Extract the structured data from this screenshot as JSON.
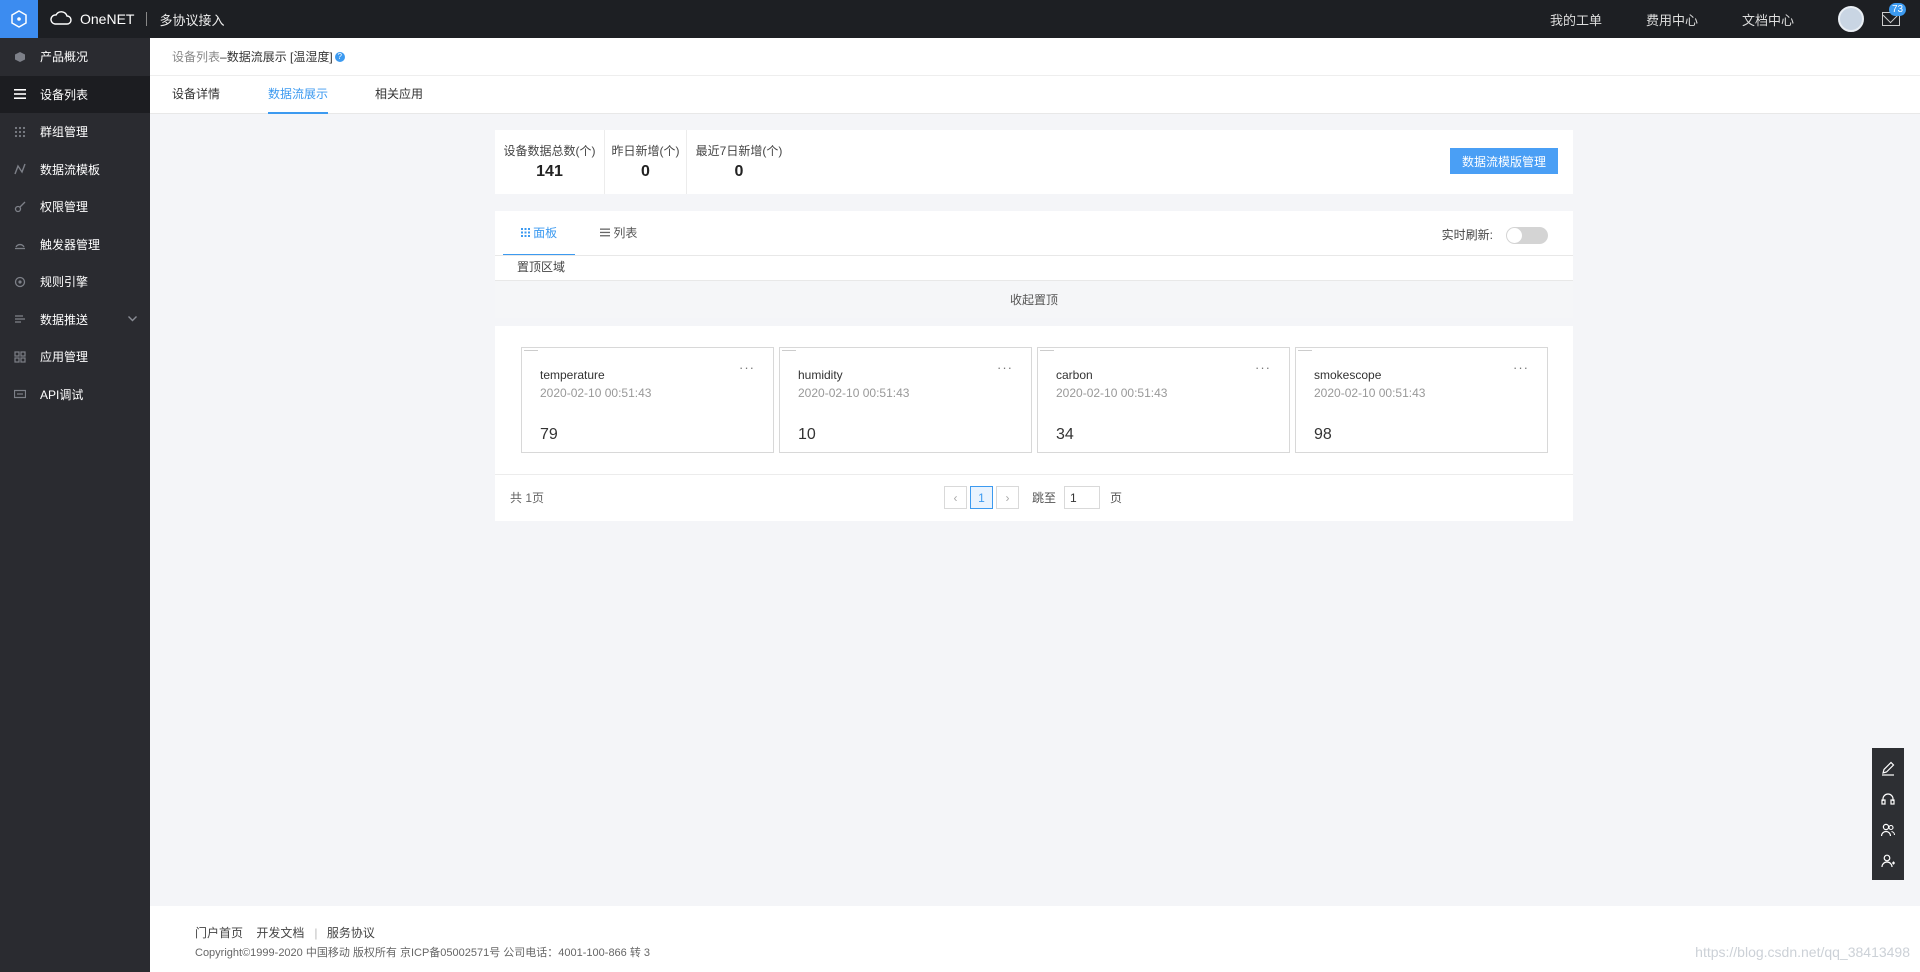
{
  "topbar": {
    "brand": "OneNET",
    "subtitle": "多协议接入",
    "links": [
      "我的工单",
      "费用中心",
      "文档中心"
    ],
    "mail_badge": "73"
  },
  "sidebar": {
    "items": [
      {
        "label": "产品概况",
        "icon": "cube-icon"
      },
      {
        "label": "设备列表",
        "icon": "list-icon",
        "active": true
      },
      {
        "label": "群组管理",
        "icon": "grid-dots-icon"
      },
      {
        "label": "数据流模板",
        "icon": "line-chart-icon"
      },
      {
        "label": "权限管理",
        "icon": "key-icon"
      },
      {
        "label": "触发器管理",
        "icon": "trigger-icon"
      },
      {
        "label": "规则引擎",
        "icon": "rule-icon"
      },
      {
        "label": "数据推送",
        "icon": "push-icon",
        "expandable": true
      },
      {
        "label": "应用管理",
        "icon": "apps-icon"
      },
      {
        "label": "API调试",
        "icon": "api-icon"
      }
    ]
  },
  "breadcrumb": {
    "parent": "设备列表",
    "separator": " – ",
    "current": "数据流展示 [温湿度]",
    "help": "?"
  },
  "tabs": [
    "设备详情",
    "数据流展示",
    "相关应用"
  ],
  "stats": [
    {
      "label": "设备数据总数(个)",
      "value": "141"
    },
    {
      "label": "昨日新增(个)",
      "value": "0"
    },
    {
      "label": "最近7日新增(个)",
      "value": "0"
    }
  ],
  "manage_button": "数据流模版管理",
  "view_tabs": {
    "panel": "面板",
    "list": "列表"
  },
  "realtime_refresh": "实时刷新:",
  "realtime_refresh_on": false,
  "pin_area": "置顶区域",
  "collapse_pin": "收起置顶",
  "streams": [
    {
      "name": "temperature",
      "time": "2020-02-10 00:51:43",
      "value": "79"
    },
    {
      "name": "humidity",
      "time": "2020-02-10 00:51:43",
      "value": "10"
    },
    {
      "name": "carbon",
      "time": "2020-02-10 00:51:43",
      "value": "34"
    },
    {
      "name": "smokescope",
      "time": "2020-02-10 00:51:43",
      "value": "98"
    }
  ],
  "pagination": {
    "total": "共 1页",
    "prev": "‹",
    "current": "1",
    "next": "›",
    "jump_label": "跳至",
    "jump_value": "1",
    "page_unit": "页"
  },
  "footer": {
    "links": [
      "门户首页",
      "开发文档",
      "服务协议"
    ],
    "copyright": "Copyright©1999-2020 中国移动 版权所有 京ICP备05002571号 公司电话：4001-100-866 转 3",
    "watermark": "https://blog.csdn.net/qq_38413498"
  },
  "floating_toolbar": [
    "edit-icon",
    "headset-icon",
    "users-icon",
    "user-add-icon"
  ]
}
